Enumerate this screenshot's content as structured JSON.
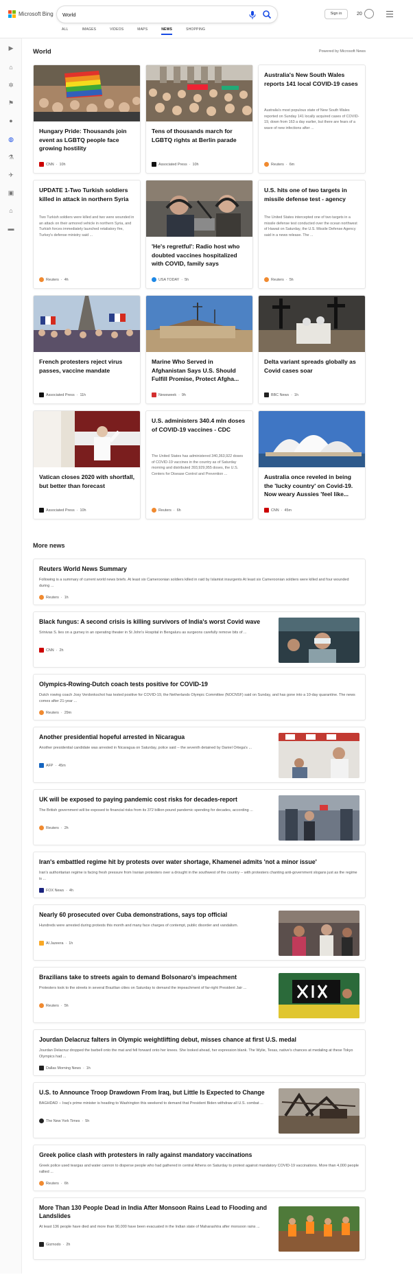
{
  "header": {
    "logo_text": "Microsoft Bing",
    "search_value": "World",
    "tabs": [
      "ALL",
      "IMAGES",
      "VIDEOS",
      "MAPS",
      "NEWS",
      "SHOPPING"
    ],
    "active_tab": "NEWS",
    "sign_in_label": "Sign in",
    "rewards_count": "20"
  },
  "sidebar": {
    "icons": [
      "expand-icon",
      "home-icon",
      "coronavirus-icon",
      "flag-icon",
      "location-icon",
      "globe-icon",
      "science-icon",
      "sports-icon",
      "entertainment-icon",
      "politics-icon",
      "money-icon"
    ]
  },
  "section": {
    "title": "World",
    "powered_by": "Powered by Microsoft News"
  },
  "cards": [
    {
      "title": "Hungary Pride: Thousands join event as LGBTQ people face growing hostility",
      "source": "CNN",
      "age": "10h",
      "fav_color": "#cc0000",
      "image": "pride-crowd"
    },
    {
      "title": "Tens of thousands march for LGBTQ rights at Berlin parade",
      "source": "Associated Press",
      "age": "10h",
      "fav_color": "#111111",
      "image": "berlin-crowd"
    },
    {
      "title": "Australia's New South Wales reports 141 local COVID-19 cases",
      "snippet": "Australia's most populous state of New South Wales reported on Sunday 141 locally acquired cases of COVID-19, down from 163 a day earlier, but there are fears of a wave of new infections after ...",
      "source": "Reuters",
      "age": "6m",
      "fav_color": "#f08a30"
    },
    {
      "title": "UPDATE 1-Two Turkish soldiers killed in attack in northern Syria",
      "snippet": "Two Turkish soldiers were killed and two were wounded in an attack on their armored vehicle in northern Syria, and Turkish forces immediately launched retaliatory fire, Turkey's defense ministry said ...",
      "source": "Reuters",
      "age": "4h",
      "fav_color": "#f08a30"
    },
    {
      "title": "'He's regretful': Radio host who doubted vaccines hospitalized with COVID, family says",
      "source": "USA TODAY",
      "age": "5h",
      "fav_color": "#1e88e5",
      "image": "radio-studio"
    },
    {
      "title": "U.S. hits one of two targets in missile defense test - agency",
      "snippet": "The United States intercepted one of two targets in a missile defense test conducted over the ocean northwest of Hawaii on Saturday, the U.S. Missile Defense Agency said in a news release. The ...",
      "source": "Reuters",
      "age": "5h",
      "fav_color": "#f08a30"
    },
    {
      "title": "French protesters reject virus passes, vaccine mandate",
      "source": "Associated Press",
      "age": "11h",
      "fav_color": "#111111",
      "image": "paris-protest"
    },
    {
      "title": "Marine Who Served in Afghanistan Says U.S. Should Fulfill Promise, Protect Afgha...",
      "source": "Newsweek",
      "age": "9h",
      "fav_color": "#d32f2f",
      "image": "military-base"
    },
    {
      "title": "Delta variant spreads globally as Covid cases soar",
      "source": "BBC News",
      "age": "1h",
      "fav_color": "#222222",
      "image": "burial"
    },
    {
      "title": "Vatican closes 2020 with shortfall, but better than forecast",
      "source": "Associated Press",
      "age": "10h",
      "fav_color": "#111111",
      "image": "pope"
    },
    {
      "title": "U.S. administers 340.4 mln doses of COVID-19 vaccines - CDC",
      "snippet": "The United States has administered 340,363,922 doses of COVID-19 vaccines in the country as of Saturday morning and distributed 393,929,955 doses, the U.S. Centers for Disease Control and Prevention ...",
      "source": "Reuters",
      "age": "6h",
      "fav_color": "#f08a30"
    },
    {
      "title": "Australia once reveled in being the 'lucky country' on Covid-19. Now weary Aussies 'feel like...",
      "source": "CNN",
      "age": "45m",
      "fav_color": "#cc0000",
      "image": "opera-house"
    }
  ],
  "more_news": {
    "title": "More news",
    "items": [
      {
        "title": "Reuters World News Summary",
        "snippet": "Following is a summary of current world news briefs. At least six Cameroonian soldiers killed in raid by Islamist insurgents At least six Cameroonian soldiers were killed and four wounded during ...",
        "source": "Reuters",
        "age": "1h",
        "fav_color": "#f08a30"
      },
      {
        "title": "Black fungus: A second crisis is killing survivors of India's worst Covid wave",
        "snippet": "Srinivas S. lies on a gurney in an operating theater in St John's Hospital in Bengaluru as surgeons carefully remove bits of ...",
        "source": "CNN",
        "age": "2h",
        "fav_color": "#cc0000",
        "image": "hospital"
      },
      {
        "title": "Olympics-Rowing-Dutch coach tests positive for COVID-19",
        "snippet": "Dutch rowing coach Josy Verdonkschot has tested positive for COVID-19, the Netherlands Olympic Committee (NOCNSF) said on Sunday, and has gone into a 10-day quarantine. The news comes after 21-year ...",
        "source": "Reuters",
        "age": "29m",
        "fav_color": "#f08a30"
      },
      {
        "title": "Another presidential hopeful arrested in Nicaragua",
        "snippet": "Another presidential candidate was arrested in Nicaragua on Saturday, police said -- the seventh detained by Daniel Ortega's ...",
        "source": "AFP",
        "age": "45m",
        "fav_color": "#1565c0",
        "image": "speaker"
      },
      {
        "title": "UK will be exposed to paying pandemic cost risks for decades-report",
        "snippet": "The British government will be exposed to financial risks from its 372 billion pound pandemic spending for decades, according ...",
        "source": "Reuters",
        "age": "2h",
        "fav_color": "#f08a30",
        "image": "train"
      },
      {
        "title": "Iran's embattled regime hit by protests over water shortage, Khamenei admits 'not a minor issue'",
        "snippet": "Iran's authoritarian regime is facing fresh pressure from Iranian protesters over a drought in the southwest of the country -- with protesters chanting anti-government slogans just as the regime is ...",
        "source": "FOX News",
        "age": "4h",
        "fav_color": "#1a237e"
      },
      {
        "title": "Nearly 60 prosecuted over Cuba demonstrations, says top official",
        "snippet": "Hundreds were arrested during protests this month and many face charges of contempt, public disorder and vandalism.",
        "source": "Al Jazeera",
        "age": "1h",
        "fav_color": "#f9a825",
        "image": "cuba"
      },
      {
        "title": "Brazilians take to streets again to demand Bolsonaro's impeachment",
        "snippet": "Protesters took to the streets in several Brazilian cities on Saturday to demand the impeachment of far-right President Jair ...",
        "source": "Reuters",
        "age": "5h",
        "fav_color": "#f08a30",
        "image": "brazil"
      },
      {
        "title": "Jourdan Delacruz falters in Olympic weightlifting debut, misses chance at first U.S. medal",
        "snippet": "Jourdan Delacruz dropped the barbell onto the mat and fell forward onto her knees. She looked ahead, her expression blank. The Wylie, Texas, native's chances at medaling at these Tokyo Olympics had ...",
        "source": "Dallas Morning News",
        "age": "1h",
        "fav_color": "#222222"
      },
      {
        "title": "U.S. to Announce Troop Drawdown From Iraq, but Little Is Expected to Change",
        "snippet": "BAGHDAD -- Iraq's prime minister is heading to Washington this weekend to demand that President Biden withdraw all U.S. combat ...",
        "source": "The New York Times",
        "age": "5h",
        "fav_color": "#222222",
        "image": "rubble"
      },
      {
        "title": "Greek police clash with protesters in rally against mandatory vaccinations",
        "snippet": "Greek police used teargas and water cannon to disperse people who had gathered in central Athens on Saturday to protest against mandatory COVID-19 vaccinations. More than 4,000 people rallied ...",
        "source": "Reuters",
        "age": "6h",
        "fav_color": "#f08a30"
      },
      {
        "title": "More Than 130 People Dead in India After Monsoon Rains Lead to Flooding and Landslides",
        "snippet": "At least 136 people have died and more than 90,000 have been evacuated in the Indian state of Maharashtra after monsoon rains ...",
        "source": "Gizmodo",
        "age": "2h",
        "fav_color": "#222222",
        "image": "rescue"
      }
    ]
  }
}
